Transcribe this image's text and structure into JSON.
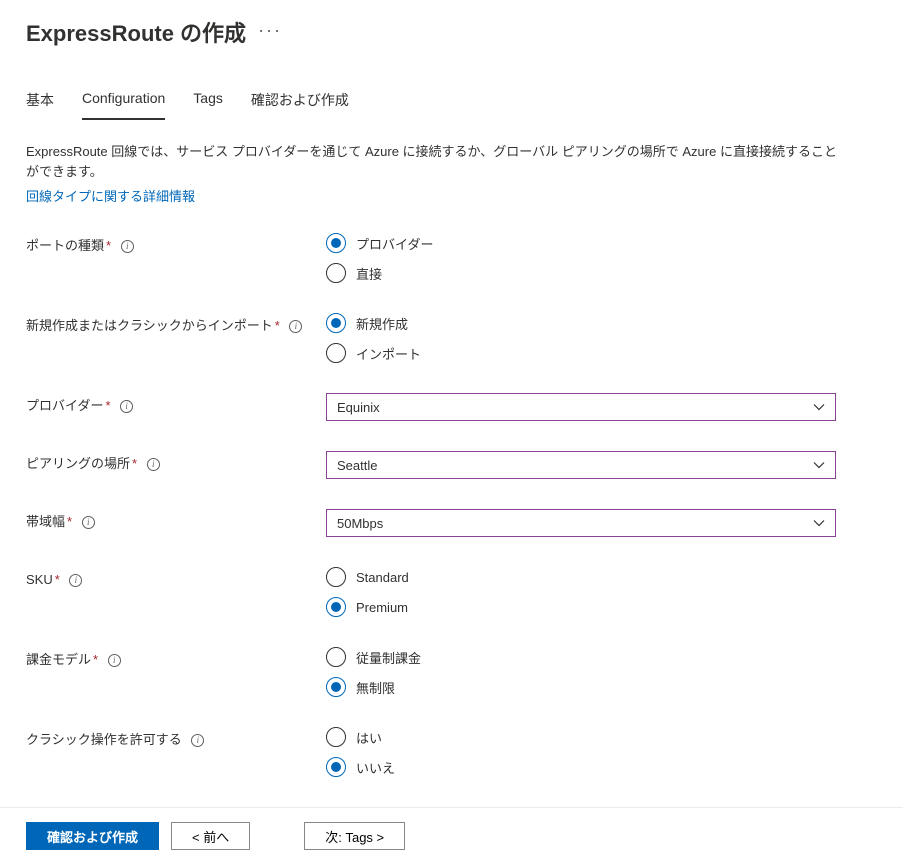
{
  "header": {
    "title": "ExpressRoute の作成",
    "more": "···"
  },
  "tabs": {
    "basics": "基本",
    "configuration": "Configuration",
    "tags": "Tags",
    "review": "確認および作成"
  },
  "description": "ExpressRoute 回線では、サービス プロバイダーを通じて Azure に接続するか、グローバル ピアリングの場所で Azure に直接接続することができます。",
  "learnMoreLink": "回線タイプに関する詳細情報",
  "fields": {
    "portType": {
      "label": "ポートの種類",
      "options": {
        "provider": "プロバイダー",
        "direct": "直接"
      }
    },
    "createOrImport": {
      "label": "新規作成またはクラシックからインポート",
      "options": {
        "createNew": "新規作成",
        "import": "インポート"
      }
    },
    "provider": {
      "label": "プロバイダー",
      "value": "Equinix"
    },
    "peeringLocation": {
      "label": "ピアリングの場所",
      "value": "Seattle"
    },
    "bandwidth": {
      "label": "帯域幅",
      "value": "50Mbps"
    },
    "sku": {
      "label": "SKU",
      "options": {
        "standard": "Standard",
        "premium": "Premium"
      }
    },
    "billingModel": {
      "label": "課金モデル",
      "options": {
        "metered": "従量制課金",
        "unlimited": "無制限"
      }
    },
    "allowClassic": {
      "label": "クラシック操作を許可する",
      "options": {
        "yes": "はい",
        "no": "いいえ"
      }
    }
  },
  "footer": {
    "review": "確認および作成",
    "previous": "< 前へ",
    "next": "次: Tags >"
  },
  "icons": {
    "info": "i"
  }
}
